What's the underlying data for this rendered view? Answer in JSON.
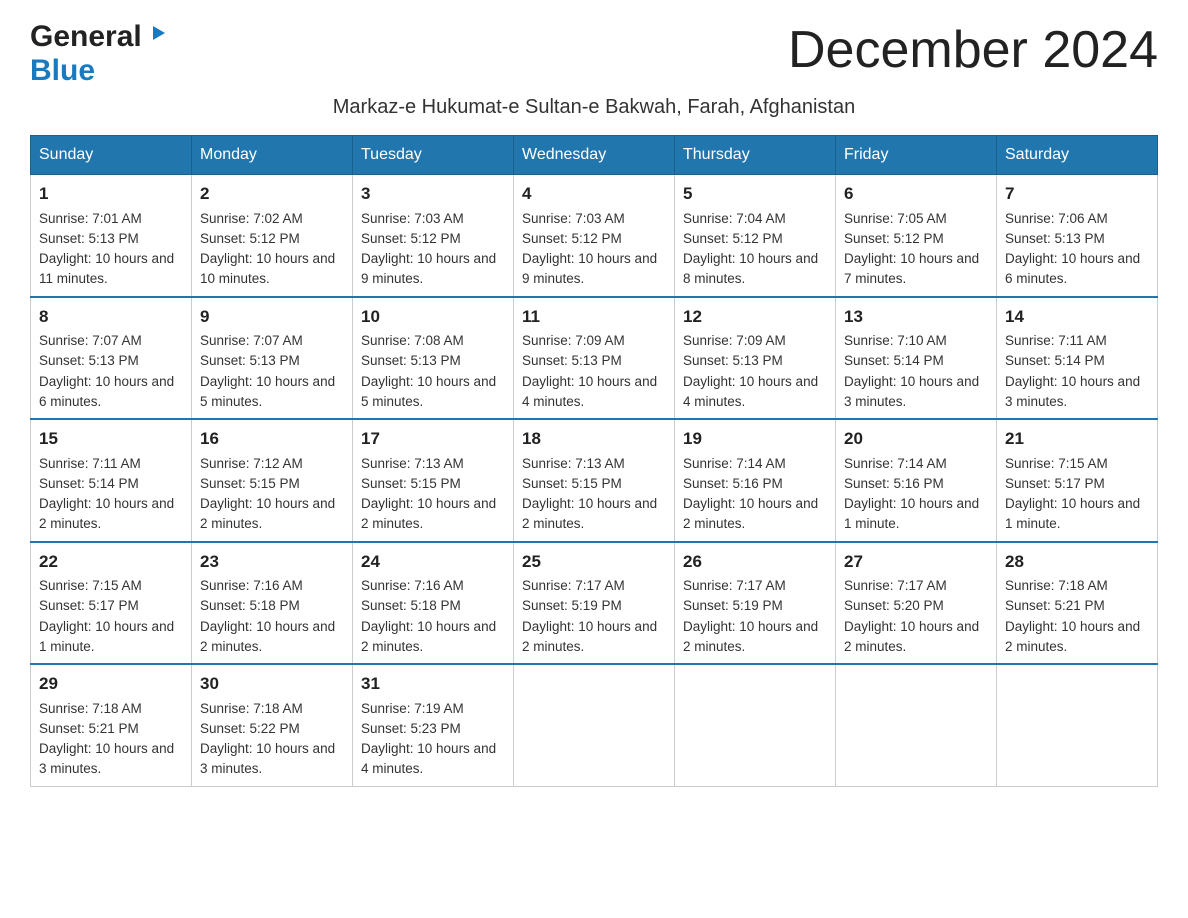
{
  "header": {
    "logo_general": "General",
    "logo_blue": "Blue",
    "title": "December 2024",
    "subtitle": "Markaz-e Hukumat-e Sultan-e Bakwah, Farah, Afghanistan"
  },
  "days_of_week": [
    "Sunday",
    "Monday",
    "Tuesday",
    "Wednesday",
    "Thursday",
    "Friday",
    "Saturday"
  ],
  "weeks": [
    {
      "days": [
        {
          "number": "1",
          "sunrise": "Sunrise: 7:01 AM",
          "sunset": "Sunset: 5:13 PM",
          "daylight": "Daylight: 10 hours and 11 minutes."
        },
        {
          "number": "2",
          "sunrise": "Sunrise: 7:02 AM",
          "sunset": "Sunset: 5:12 PM",
          "daylight": "Daylight: 10 hours and 10 minutes."
        },
        {
          "number": "3",
          "sunrise": "Sunrise: 7:03 AM",
          "sunset": "Sunset: 5:12 PM",
          "daylight": "Daylight: 10 hours and 9 minutes."
        },
        {
          "number": "4",
          "sunrise": "Sunrise: 7:03 AM",
          "sunset": "Sunset: 5:12 PM",
          "daylight": "Daylight: 10 hours and 9 minutes."
        },
        {
          "number": "5",
          "sunrise": "Sunrise: 7:04 AM",
          "sunset": "Sunset: 5:12 PM",
          "daylight": "Daylight: 10 hours and 8 minutes."
        },
        {
          "number": "6",
          "sunrise": "Sunrise: 7:05 AM",
          "sunset": "Sunset: 5:12 PM",
          "daylight": "Daylight: 10 hours and 7 minutes."
        },
        {
          "number": "7",
          "sunrise": "Sunrise: 7:06 AM",
          "sunset": "Sunset: 5:13 PM",
          "daylight": "Daylight: 10 hours and 6 minutes."
        }
      ]
    },
    {
      "days": [
        {
          "number": "8",
          "sunrise": "Sunrise: 7:07 AM",
          "sunset": "Sunset: 5:13 PM",
          "daylight": "Daylight: 10 hours and 6 minutes."
        },
        {
          "number": "9",
          "sunrise": "Sunrise: 7:07 AM",
          "sunset": "Sunset: 5:13 PM",
          "daylight": "Daylight: 10 hours and 5 minutes."
        },
        {
          "number": "10",
          "sunrise": "Sunrise: 7:08 AM",
          "sunset": "Sunset: 5:13 PM",
          "daylight": "Daylight: 10 hours and 5 minutes."
        },
        {
          "number": "11",
          "sunrise": "Sunrise: 7:09 AM",
          "sunset": "Sunset: 5:13 PM",
          "daylight": "Daylight: 10 hours and 4 minutes."
        },
        {
          "number": "12",
          "sunrise": "Sunrise: 7:09 AM",
          "sunset": "Sunset: 5:13 PM",
          "daylight": "Daylight: 10 hours and 4 minutes."
        },
        {
          "number": "13",
          "sunrise": "Sunrise: 7:10 AM",
          "sunset": "Sunset: 5:14 PM",
          "daylight": "Daylight: 10 hours and 3 minutes."
        },
        {
          "number": "14",
          "sunrise": "Sunrise: 7:11 AM",
          "sunset": "Sunset: 5:14 PM",
          "daylight": "Daylight: 10 hours and 3 minutes."
        }
      ]
    },
    {
      "days": [
        {
          "number": "15",
          "sunrise": "Sunrise: 7:11 AM",
          "sunset": "Sunset: 5:14 PM",
          "daylight": "Daylight: 10 hours and 2 minutes."
        },
        {
          "number": "16",
          "sunrise": "Sunrise: 7:12 AM",
          "sunset": "Sunset: 5:15 PM",
          "daylight": "Daylight: 10 hours and 2 minutes."
        },
        {
          "number": "17",
          "sunrise": "Sunrise: 7:13 AM",
          "sunset": "Sunset: 5:15 PM",
          "daylight": "Daylight: 10 hours and 2 minutes."
        },
        {
          "number": "18",
          "sunrise": "Sunrise: 7:13 AM",
          "sunset": "Sunset: 5:15 PM",
          "daylight": "Daylight: 10 hours and 2 minutes."
        },
        {
          "number": "19",
          "sunrise": "Sunrise: 7:14 AM",
          "sunset": "Sunset: 5:16 PM",
          "daylight": "Daylight: 10 hours and 2 minutes."
        },
        {
          "number": "20",
          "sunrise": "Sunrise: 7:14 AM",
          "sunset": "Sunset: 5:16 PM",
          "daylight": "Daylight: 10 hours and 1 minute."
        },
        {
          "number": "21",
          "sunrise": "Sunrise: 7:15 AM",
          "sunset": "Sunset: 5:17 PM",
          "daylight": "Daylight: 10 hours and 1 minute."
        }
      ]
    },
    {
      "days": [
        {
          "number": "22",
          "sunrise": "Sunrise: 7:15 AM",
          "sunset": "Sunset: 5:17 PM",
          "daylight": "Daylight: 10 hours and 1 minute."
        },
        {
          "number": "23",
          "sunrise": "Sunrise: 7:16 AM",
          "sunset": "Sunset: 5:18 PM",
          "daylight": "Daylight: 10 hours and 2 minutes."
        },
        {
          "number": "24",
          "sunrise": "Sunrise: 7:16 AM",
          "sunset": "Sunset: 5:18 PM",
          "daylight": "Daylight: 10 hours and 2 minutes."
        },
        {
          "number": "25",
          "sunrise": "Sunrise: 7:17 AM",
          "sunset": "Sunset: 5:19 PM",
          "daylight": "Daylight: 10 hours and 2 minutes."
        },
        {
          "number": "26",
          "sunrise": "Sunrise: 7:17 AM",
          "sunset": "Sunset: 5:19 PM",
          "daylight": "Daylight: 10 hours and 2 minutes."
        },
        {
          "number": "27",
          "sunrise": "Sunrise: 7:17 AM",
          "sunset": "Sunset: 5:20 PM",
          "daylight": "Daylight: 10 hours and 2 minutes."
        },
        {
          "number": "28",
          "sunrise": "Sunrise: 7:18 AM",
          "sunset": "Sunset: 5:21 PM",
          "daylight": "Daylight: 10 hours and 2 minutes."
        }
      ]
    },
    {
      "days": [
        {
          "number": "29",
          "sunrise": "Sunrise: 7:18 AM",
          "sunset": "Sunset: 5:21 PM",
          "daylight": "Daylight: 10 hours and 3 minutes."
        },
        {
          "number": "30",
          "sunrise": "Sunrise: 7:18 AM",
          "sunset": "Sunset: 5:22 PM",
          "daylight": "Daylight: 10 hours and 3 minutes."
        },
        {
          "number": "31",
          "sunrise": "Sunrise: 7:19 AM",
          "sunset": "Sunset: 5:23 PM",
          "daylight": "Daylight: 10 hours and 4 minutes."
        },
        null,
        null,
        null,
        null
      ]
    }
  ]
}
